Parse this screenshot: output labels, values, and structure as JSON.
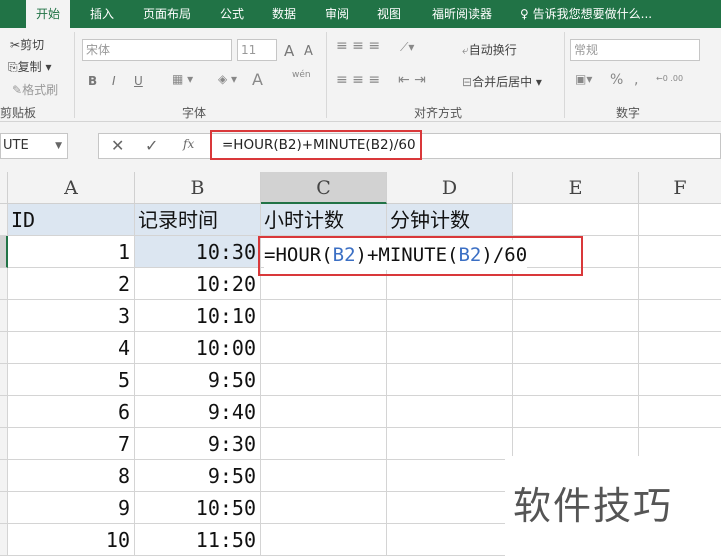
{
  "tabs": [
    "开始",
    "插入",
    "页面布局",
    "公式",
    "数据",
    "审阅",
    "视图",
    "福昕阅读器"
  ],
  "tell_me": "告诉我您想要做什么...",
  "ribbon": {
    "cut": "剪切",
    "copy": "复制",
    "format_painter": "格式刷",
    "clipboard": "剪贴板",
    "font_name": "宋体",
    "font_size": "11",
    "bold": "B",
    "italic": "I",
    "underline": "U",
    "font_group": "字体",
    "wrap": "自动换行",
    "merge": "合并后居中",
    "align_group": "对齐方式",
    "number_format": "常规",
    "percent": "%",
    "comma": ",",
    "number_group": "数字",
    "font_color": "A",
    "grow": "A",
    "shrink": "A",
    "phonetic": "wén"
  },
  "namebox": "UTE",
  "formula": "=HOUR(B2)+MINUTE(B2)/60",
  "columns": [
    "A",
    "B",
    "C",
    "D",
    "E",
    "F"
  ],
  "headers": [
    "ID",
    "记录时间",
    "小时计数",
    "分钟计数"
  ],
  "rows": [
    [
      "1",
      "10:30"
    ],
    [
      "2",
      "10:20"
    ],
    [
      "3",
      "10:10"
    ],
    [
      "4",
      "10:00"
    ],
    [
      "5",
      "9:50"
    ],
    [
      "6",
      "9:40"
    ],
    [
      "7",
      "9:30"
    ],
    [
      "8",
      "9:50"
    ],
    [
      "9",
      "10:50"
    ],
    [
      "10",
      "11:50"
    ]
  ],
  "edit": {
    "p1": "=HOUR(",
    "r1": "B2",
    "p2": ")+MINUTE(",
    "r2": "B2",
    "p3": ")/60"
  },
  "watermark": "软件技巧",
  "accent": "#217346",
  "highlight": "#d9383a"
}
